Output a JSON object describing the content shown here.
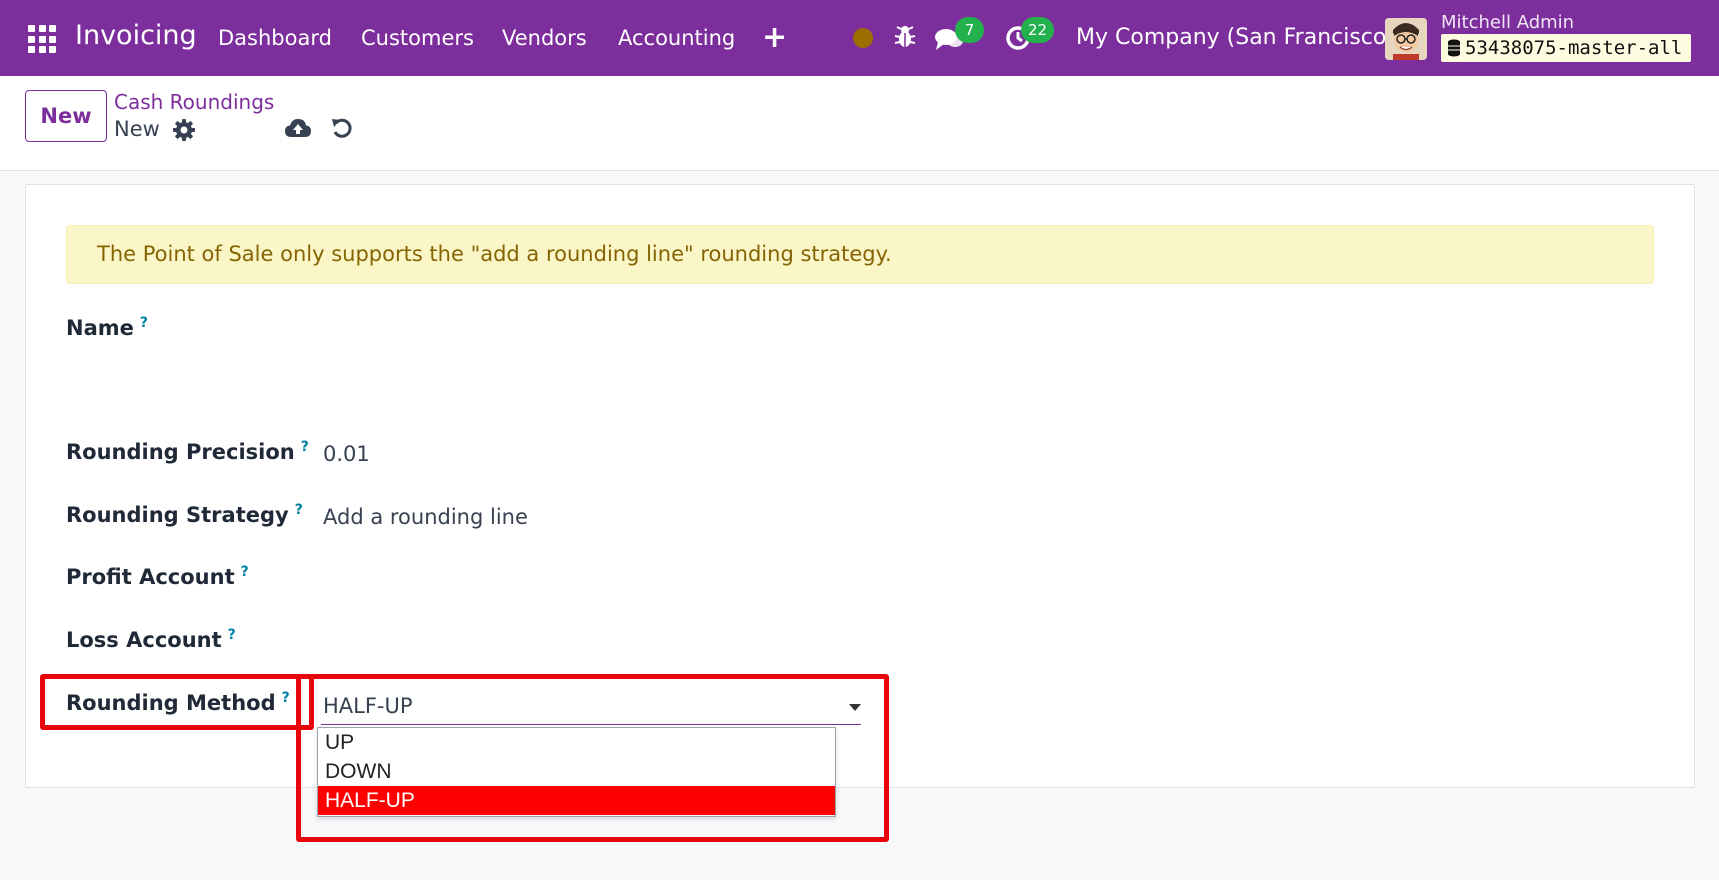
{
  "navbar": {
    "app_name": "Invoicing",
    "menu": [
      "Dashboard",
      "Customers",
      "Vendors",
      "Accounting"
    ],
    "chat_badge": "7",
    "activity_badge": "22",
    "company": "My Company (San Francisco)",
    "user_name": "Mitchell Admin",
    "database": "53438075-master-all",
    "icons": [
      "apps-grid-icon",
      "plus-icon",
      "status-dot",
      "bug-icon",
      "chat-icon",
      "clock-icon",
      "database-icon"
    ],
    "colors": {
      "bar": "#7c2e9c",
      "badge": "#23b14d",
      "status_dot": "#9a6e00"
    }
  },
  "control_panel": {
    "new_label": "New",
    "breadcrumb_parent": "Cash Roundings",
    "breadcrumb_current": "New",
    "icons": [
      "gear-icon",
      "cloud-upload-icon",
      "undo-icon"
    ]
  },
  "form": {
    "alert": "The Point of Sale only supports the \"add a rounding line\" rounding strategy.",
    "help_mark": "?",
    "fields": {
      "name": {
        "label": "Name",
        "value": ""
      },
      "precision": {
        "label": "Rounding Precision",
        "value": "0.01"
      },
      "strategy": {
        "label": "Rounding Strategy",
        "value": "Add a rounding line"
      },
      "profit": {
        "label": "Profit Account",
        "value": ""
      },
      "loss": {
        "label": "Loss Account",
        "value": ""
      },
      "method": {
        "label": "Rounding Method",
        "value": "HALF-UP",
        "options": [
          "UP",
          "DOWN",
          "HALF-UP"
        ],
        "selected_option": "HALF-UP"
      }
    },
    "colors": {
      "alert_bg": "#fbf6c7",
      "alert_text": "#856404",
      "highlight": "#e8060c",
      "selected_option": "#ff0000"
    }
  }
}
